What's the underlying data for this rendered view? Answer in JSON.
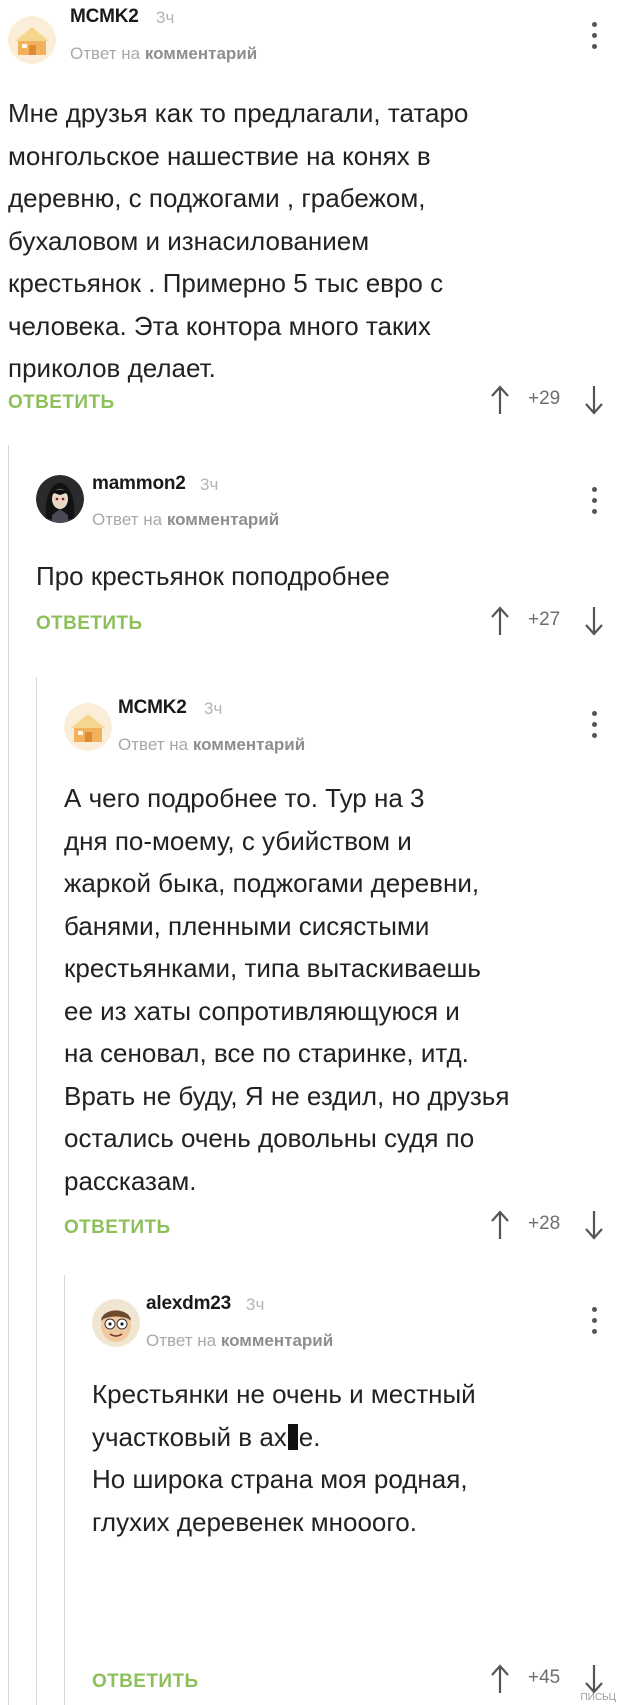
{
  "comments": [
    {
      "author": "MCMK2",
      "time": "3ч",
      "reply_prefix": "Ответ на",
      "reply_link": "комментарий",
      "text": "Мне друзья как то предлагали, татаро\nмонгольское нашествие на конях в\nдеревню, с поджогами , грабежом,\nбухаловом и изнасилованием\nкрестьянок . Примерно 5 тыс евро с\nчеловека. Эта контора много таких\nприколов делает.",
      "reply_label": "ОТВЕТИТЬ",
      "score": "+29"
    },
    {
      "author": "mammon2",
      "time": "3ч",
      "reply_prefix": "Ответ на",
      "reply_link": "комментарий",
      "text": "Про крестьянок поподробнее",
      "reply_label": "ОТВЕТИТЬ",
      "score": "+27"
    },
    {
      "author": "MCMK2",
      "time": "3ч",
      "reply_prefix": "Ответ на",
      "reply_link": "комментарий",
      "text": "А чего подробнее то. Тур на 3\nдня по-моему, с убийством и\nжаркой быка, поджогами деревни,\nбанями, пленными сисястыми\nкрестьянками, типа вытаскиваешь\nее из хаты сопротивляющуюся и\nна сеновал, все по старинке, итд.\nВрать не буду, Я не ездил, но друзья\nостались очень довольны судя по\nрассказам.",
      "reply_label": "ОТВЕТИТЬ",
      "score": "+28"
    },
    {
      "author": "alexdm23",
      "time": "3ч",
      "reply_prefix": "Ответ на",
      "reply_link": "комментарий",
      "text_line1": "Крестьянки не очень и местный",
      "text_line2_a": "участковый в ах",
      "text_line2_b": "е.",
      "text_rest": "Но широка страна моя родная,\nглухих деревенек мнооого.",
      "reply_label": "ОТВЕТИТЬ",
      "score": "+45"
    }
  ],
  "watermark": "ПИСЬЦ",
  "colors": {
    "accent_green": "#8dbf5a",
    "meta_gray": "#a8a8a8",
    "thread_line": "#d6d6d6"
  },
  "icons": [
    "home-avatar-icon",
    "anime-avatar-icon",
    "cartoon-avatar-icon",
    "more-vert-icon",
    "arrow-up-icon",
    "arrow-down-icon"
  ]
}
